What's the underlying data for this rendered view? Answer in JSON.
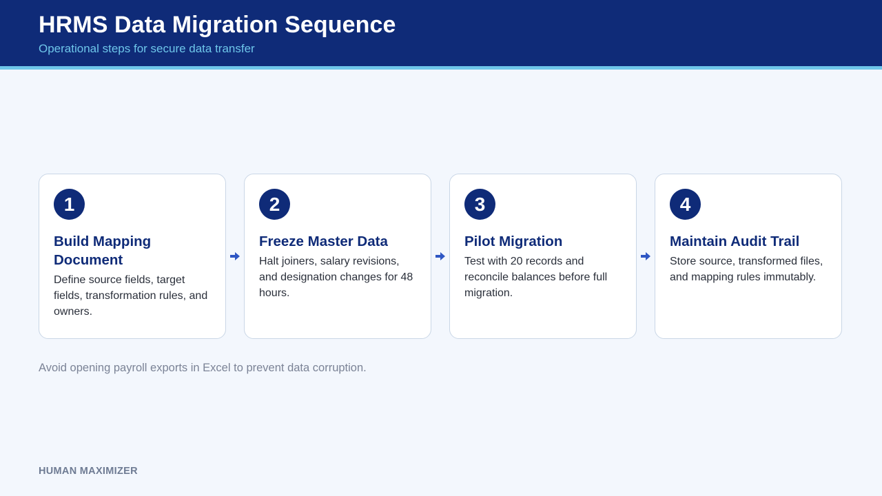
{
  "header": {
    "title": "HRMS Data Migration Sequence",
    "subtitle": "Operational steps for secure data transfer"
  },
  "steps": [
    {
      "number": "1",
      "title": "Build Mapping Document",
      "description": "Define source fields, target fields, transformation rules, and owners."
    },
    {
      "number": "2",
      "title": "Freeze Master Data",
      "description": "Halt joiners, salary revisions, and designation changes for 48 hours."
    },
    {
      "number": "3",
      "title": "Pilot Migration",
      "description": "Test with 20 records and reconcile balances before full migration."
    },
    {
      "number": "4",
      "title": "Maintain Audit Trail",
      "description": "Store source, transformed files, and mapping rules immutably."
    }
  ],
  "note": "Avoid opening payroll exports in Excel to prevent data corruption.",
  "footer": {
    "brand": "HUMAN MAXIMIZER"
  },
  "colors": {
    "header_bg": "#0f2b78",
    "accent": "#6ec6ea",
    "page_bg": "#f3f7fd",
    "connector": "#2f57c4"
  },
  "icons": {
    "connector": "arrow-right-icon"
  }
}
